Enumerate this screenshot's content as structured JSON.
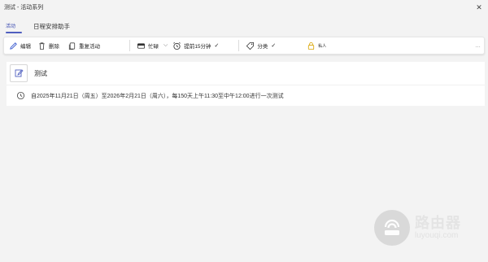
{
  "window": {
    "title": "测试 - 活动系列",
    "close_label": "✕"
  },
  "tabs": [
    {
      "label": "活动"
    },
    {
      "label": "日程安排助手"
    }
  ],
  "toolbar": {
    "edit": "编辑",
    "delete": "删除",
    "recur": "重复活动",
    "busy": "忙碌",
    "reminder": "提前15分钟",
    "check": "✓",
    "category": "分类",
    "private": "私人",
    "more": "…"
  },
  "event": {
    "title": "测试",
    "recurrence": "自2025年11月21日（周五）至2026年2月21日（周六），每150天上午11:30至中午12:00进行一次测试"
  },
  "watermark": {
    "cn": "路由器",
    "en": "luyouqi.com"
  },
  "colors": {
    "accent": "#4f5fbf",
    "background": "#f3f3f3",
    "card": "#ffffff"
  }
}
